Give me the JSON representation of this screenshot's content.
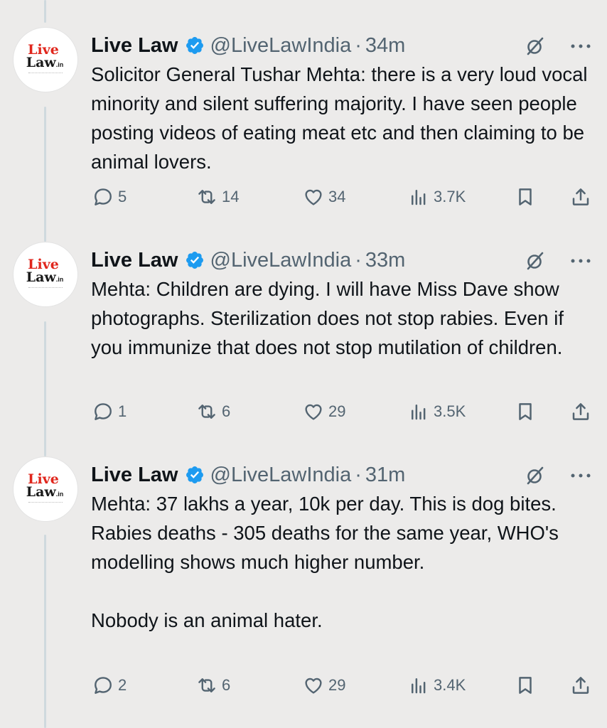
{
  "colors": {
    "background": "#ecebea",
    "text": "#0f1419",
    "muted": "#536471",
    "verified": "#1d9bf0",
    "brand_red": "#e0261c",
    "thread_line": "#cfd9de"
  },
  "logo": {
    "line1": "Live",
    "line2": "Law",
    "suffix": ".in",
    "tagline": "ALL ABOUT LAW"
  },
  "tweets": [
    {
      "author": "Live Law",
      "handle": "@LiveLawIndia",
      "separator": "·",
      "time": "34m",
      "text": "Solicitor General Tushar Mehta: there is a very loud vocal minority and silent suffering majority. I have seen people posting videos of eating meat etc and then claiming to be animal lovers.",
      "replies": "5",
      "reposts": "14",
      "likes": "34",
      "views": "3.7K"
    },
    {
      "author": "Live Law",
      "handle": "@LiveLawIndia",
      "separator": "·",
      "time": "33m",
      "text": "Mehta: Children are dying. I will have Miss Dave show photographs. Sterilization does not stop rabies. Even if you immunize that does not stop mutilation of children.",
      "replies": "1",
      "reposts": "6",
      "likes": "29",
      "views": "3.5K"
    },
    {
      "author": "Live Law",
      "handle": "@LiveLawIndia",
      "separator": "·",
      "time": "31m",
      "text": "Mehta: 37 lakhs a year, 10k per day. This is dog bites. Rabies deaths - 305 deaths for the same year, WHO's modelling shows much higher number.\n\nNobody is an animal hater.",
      "replies": "2",
      "reposts": "6",
      "likes": "29",
      "views": "3.4K"
    }
  ],
  "icons": {
    "reply": "reply-icon",
    "repost": "repost-icon",
    "like": "heart-icon",
    "views": "views-icon",
    "bookmark": "bookmark-icon",
    "share": "share-icon",
    "grok": "grok-icon",
    "more": "more-icon",
    "verified": "verified-badge-icon"
  }
}
